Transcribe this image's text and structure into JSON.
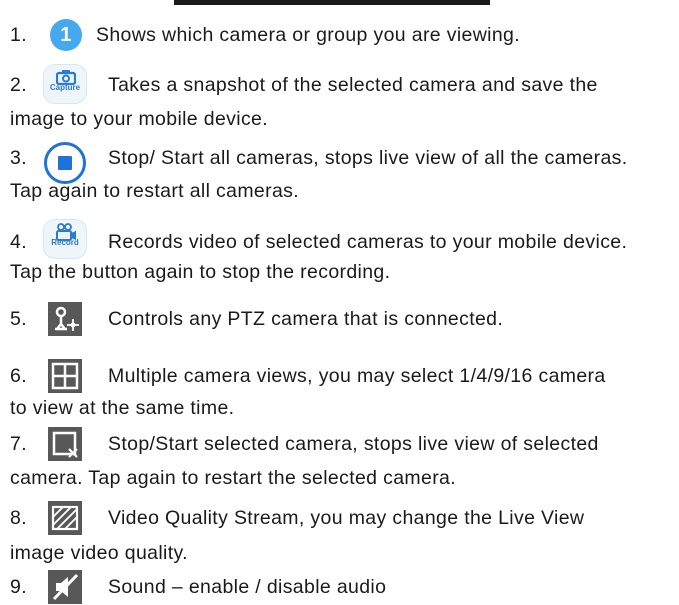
{
  "items": [
    {
      "number": "1.",
      "icon": "number-one-badge-icon",
      "badge_text": "1",
      "description": "Shows which camera or group you are viewing.",
      "continuation": ""
    },
    {
      "number": "2.",
      "icon": "capture-camera-icon",
      "icon_label": "Capture",
      "description": "Takes a snapshot of the selected camera and save the",
      "continuation": "image to your mobile device."
    },
    {
      "number": "3.",
      "icon": "stop-all-icon",
      "description": "Stop/ Start all cameras, stops live view of all the cameras.",
      "continuation": "Tap again to restart all cameras."
    },
    {
      "number": "4.",
      "icon": "record-video-icon",
      "icon_label": "Record",
      "description": "Records video of selected cameras to your mobile device.",
      "continuation": "Tap the button again to stop the recording."
    },
    {
      "number": "5.",
      "icon": "ptz-control-icon",
      "description": "Controls any PTZ camera that is connected.",
      "continuation": ""
    },
    {
      "number": "6.",
      "icon": "multi-view-grid-icon",
      "description": "Multiple camera views, you may select 1/4/9/16 camera",
      "continuation": "to view at the same time."
    },
    {
      "number": "7.",
      "icon": "stop-selected-camera-icon",
      "description": "Stop/Start selected camera, stops live view of selected",
      "continuation": "camera. Tap again to restart the selected camera."
    },
    {
      "number": "8.",
      "icon": "video-quality-icon",
      "description": "Video Quality Stream, you may change the Live View",
      "continuation": "image video quality."
    },
    {
      "number": "9.",
      "icon": "sound-mute-icon",
      "description": "Sound – enable / disable audio",
      "continuation": ""
    }
  ],
  "colors": {
    "accent_blue": "#1f73d8",
    "light_blue": "#46a8ee",
    "icon_gray": "#585858"
  }
}
